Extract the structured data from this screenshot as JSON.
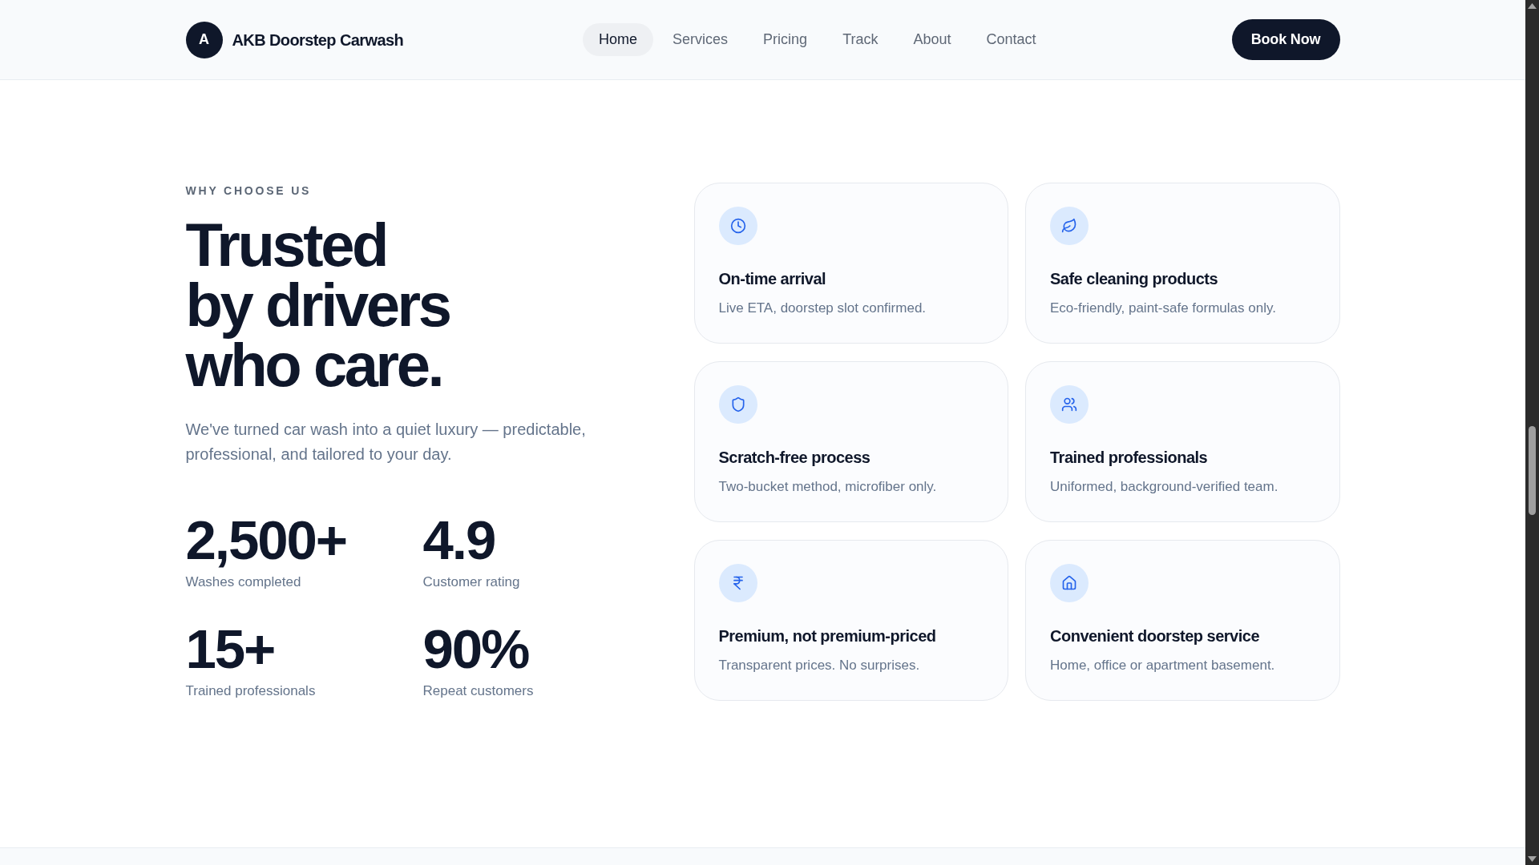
{
  "header": {
    "logo": {
      "initial": "A",
      "name": "AKB Doorstep Carwash"
    },
    "nav": [
      {
        "label": "Home",
        "selected": true
      },
      {
        "label": "Services",
        "selected": false
      },
      {
        "label": "Pricing",
        "selected": false
      },
      {
        "label": "Track",
        "selected": false
      },
      {
        "label": "About",
        "selected": false
      },
      {
        "label": "Contact",
        "selected": false
      }
    ],
    "cta": "Book Now"
  },
  "why_choose_us": {
    "eyebrow": "WHY CHOOSE US",
    "heading_lines": [
      "Trusted",
      "by drivers",
      "who care."
    ],
    "description": "We've turned car wash into a quiet luxury — predictable, professional, and tailored to your day.",
    "stats": [
      {
        "value": "2,500+",
        "label": "Washes completed"
      },
      {
        "value": "4.9",
        "label": "Customer rating"
      },
      {
        "value": "15+",
        "label": "Trained professionals"
      },
      {
        "value": "90%",
        "label": "Repeat customers"
      }
    ],
    "features": [
      {
        "kind": "timing",
        "title": "On-time arrival",
        "description": "Live ETA, doorstep slot confirmed."
      },
      {
        "kind": "products",
        "title": "Safe cleaning products",
        "description": "Eco-friendly, paint-safe formulas only."
      },
      {
        "kind": "safety",
        "title": "Scratch-free process",
        "description": "Two-bucket method, microfiber only."
      },
      {
        "kind": "team",
        "title": "Trained professionals",
        "description": "Uniformed, background-verified team."
      },
      {
        "kind": "price",
        "title": "Premium, not premium-priced",
        "description": "Transparent prices. No surprises."
      },
      {
        "kind": "location",
        "title": "Convenient doorstep service",
        "description": "Home, office or apartment basement."
      }
    ]
  }
}
